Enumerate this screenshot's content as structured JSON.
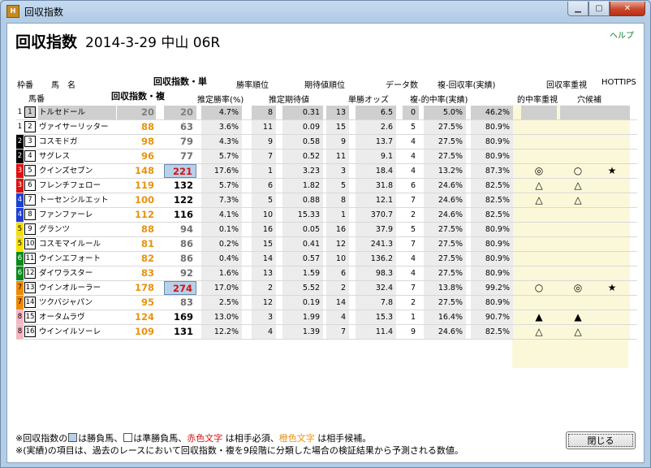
{
  "window": {
    "title": "回収指数",
    "icon_text": "H"
  },
  "header": {
    "title": "回収指数",
    "subtitle": "2014-3-29 中山 06R",
    "help": "ヘルプ"
  },
  "columns": {
    "waku": "枠番",
    "horse_name": "馬　名",
    "umaban": "馬番",
    "ri_tan": "回収指数・単",
    "ri_fuku": "回収指数・複",
    "win_rate": "推定勝率(%)",
    "win_rank": "勝率順位",
    "ev": "推定期待値",
    "ev_rank": "期待値順位",
    "odds": "単勝オッズ",
    "data_count": "データ数",
    "fuku_rate": "複-回収率(実績)",
    "hit_rate": "複-的中率(実績)",
    "hit_focus": "的中率重視",
    "ret_focus": "回収率重視",
    "ana": "穴候補",
    "hottips": "HOTTIPS"
  },
  "rows": [
    {
      "waku": "1",
      "wcol": "#ffffff",
      "wtxt": "#000",
      "uma": "1",
      "name": "トルセドール",
      "r1": "20",
      "r1c": "gray",
      "r2": "20",
      "r2c": "gray",
      "wr": "4.7%",
      "wrk": "8",
      "ev": "0.31",
      "evr": "13",
      "odds": "6.5",
      "dc": "0",
      "hit": "5.0%",
      "ret": "46.2%",
      "m1": "",
      "m2": "",
      "m3": "",
      "grayrow": true
    },
    {
      "waku": "1",
      "wcol": "#ffffff",
      "wtxt": "#000",
      "uma": "2",
      "name": "ヴァイサーリッター",
      "r1": "88",
      "r1c": "orange",
      "r2": "63",
      "r2c": "gray",
      "wr": "3.6%",
      "wrk": "11",
      "ev": "0.09",
      "evr": "15",
      "odds": "2.6",
      "dc": "5",
      "hit": "27.5%",
      "ret": "80.9%",
      "m1": "",
      "m2": "",
      "m3": ""
    },
    {
      "waku": "2",
      "wcol": "#000000",
      "wtxt": "#fff",
      "uma": "3",
      "name": "コスモドガ",
      "r1": "98",
      "r1c": "orange",
      "r2": "79",
      "r2c": "gray",
      "wr": "4.3%",
      "wrk": "9",
      "ev": "0.58",
      "evr": "9",
      "odds": "13.7",
      "dc": "4",
      "hit": "27.5%",
      "ret": "80.9%",
      "m1": "",
      "m2": "",
      "m3": ""
    },
    {
      "waku": "2",
      "wcol": "#000000",
      "wtxt": "#fff",
      "uma": "4",
      "name": "サグレス",
      "r1": "96",
      "r1c": "orange",
      "r2": "77",
      "r2c": "gray",
      "wr": "5.7%",
      "wrk": "7",
      "ev": "0.52",
      "evr": "11",
      "odds": "9.1",
      "dc": "4",
      "hit": "27.5%",
      "ret": "80.9%",
      "m1": "",
      "m2": "",
      "m3": ""
    },
    {
      "waku": "3",
      "wcol": "#e01010",
      "wtxt": "#fff",
      "uma": "5",
      "name": "クインズセブン",
      "r1": "148",
      "r1c": "orange",
      "r2": "221",
      "r2c": "red",
      "wr": "17.6%",
      "wrk": "1",
      "ev": "3.23",
      "evr": "3",
      "odds": "18.4",
      "dc": "4",
      "hit": "13.2%",
      "ret": "87.3%",
      "m1": "◎",
      "m2": "○",
      "m3": "★"
    },
    {
      "waku": "3",
      "wcol": "#e01010",
      "wtxt": "#fff",
      "uma": "6",
      "name": "フレンチフェロー",
      "r1": "119",
      "r1c": "orange",
      "r2": "132",
      "r2c": "orange",
      "wr": "5.7%",
      "wrk": "6",
      "ev": "1.82",
      "evr": "5",
      "odds": "31.8",
      "dc": "6",
      "hit": "24.6%",
      "ret": "82.5%",
      "m1": "△",
      "m2": "△",
      "m3": ""
    },
    {
      "waku": "4",
      "wcol": "#1c3fd6",
      "wtxt": "#fff",
      "uma": "7",
      "name": "トーセンシルエット",
      "r1": "100",
      "r1c": "orange",
      "r2": "122",
      "r2c": "orange",
      "wr": "7.3%",
      "wrk": "5",
      "ev": "0.88",
      "evr": "8",
      "odds": "12.1",
      "dc": "7",
      "hit": "24.6%",
      "ret": "82.5%",
      "m1": "△",
      "m2": "△",
      "m3": ""
    },
    {
      "waku": "4",
      "wcol": "#1c3fd6",
      "wtxt": "#fff",
      "uma": "8",
      "name": "ファンファーレ",
      "r1": "112",
      "r1c": "orange",
      "r2": "116",
      "r2c": "orange",
      "wr": "4.1%",
      "wrk": "10",
      "ev": "15.33",
      "evr": "1",
      "odds": "370.7",
      "dc": "2",
      "hit": "24.6%",
      "ret": "82.5%",
      "m1": "",
      "m2": "",
      "m3": ""
    },
    {
      "waku": "5",
      "wcol": "#f5e000",
      "wtxt": "#000",
      "uma": "9",
      "name": "グランツ",
      "r1": "88",
      "r1c": "orange",
      "r2": "94",
      "r2c": "gray",
      "wr": "0.1%",
      "wrk": "16",
      "ev": "0.05",
      "evr": "16",
      "odds": "37.9",
      "dc": "5",
      "hit": "27.5%",
      "ret": "80.9%",
      "m1": "",
      "m2": "",
      "m3": ""
    },
    {
      "waku": "5",
      "wcol": "#f5e000",
      "wtxt": "#000",
      "uma": "10",
      "name": "コスモマイルール",
      "r1": "81",
      "r1c": "orange",
      "r2": "86",
      "r2c": "gray",
      "wr": "0.2%",
      "wrk": "15",
      "ev": "0.41",
      "evr": "12",
      "odds": "241.3",
      "dc": "7",
      "hit": "27.5%",
      "ret": "80.9%",
      "m1": "",
      "m2": "",
      "m3": ""
    },
    {
      "waku": "6",
      "wcol": "#0a8a1a",
      "wtxt": "#fff",
      "uma": "11",
      "name": "ウインエフォート",
      "r1": "82",
      "r1c": "orange",
      "r2": "86",
      "r2c": "gray",
      "wr": "0.4%",
      "wrk": "14",
      "ev": "0.57",
      "evr": "10",
      "odds": "136.2",
      "dc": "4",
      "hit": "27.5%",
      "ret": "80.9%",
      "m1": "",
      "m2": "",
      "m3": ""
    },
    {
      "waku": "6",
      "wcol": "#0a8a1a",
      "wtxt": "#fff",
      "uma": "12",
      "name": "ダイワラスター",
      "r1": "83",
      "r1c": "orange",
      "r2": "92",
      "r2c": "gray",
      "wr": "1.6%",
      "wrk": "13",
      "ev": "1.59",
      "evr": "6",
      "odds": "98.3",
      "dc": "4",
      "hit": "27.5%",
      "ret": "80.9%",
      "m1": "",
      "m2": "",
      "m3": ""
    },
    {
      "waku": "7",
      "wcol": "#f08a00",
      "wtxt": "#000",
      "uma": "13",
      "name": "ウインオルーラー",
      "r1": "178",
      "r1c": "orange",
      "r2": "274",
      "r2c": "red",
      "wr": "17.0%",
      "wrk": "2",
      "ev": "5.52",
      "evr": "2",
      "odds": "32.4",
      "dc": "7",
      "hit": "13.8%",
      "ret": "99.2%",
      "m1": "○",
      "m2": "◎",
      "m3": "★"
    },
    {
      "waku": "7",
      "wcol": "#f08a00",
      "wtxt": "#000",
      "uma": "14",
      "name": "ツクバジャパン",
      "r1": "95",
      "r1c": "orange",
      "r2": "83",
      "r2c": "gray",
      "wr": "2.5%",
      "wrk": "12",
      "ev": "0.19",
      "evr": "14",
      "odds": "7.8",
      "dc": "2",
      "hit": "27.5%",
      "ret": "80.9%",
      "m1": "",
      "m2": "",
      "m3": ""
    },
    {
      "waku": "8",
      "wcol": "#f7b6c0",
      "wtxt": "#000",
      "uma": "15",
      "name": "オータムラヴ",
      "r1": "124",
      "r1c": "orange",
      "r2": "169",
      "r2c": "orange",
      "wr": "13.0%",
      "wrk": "3",
      "ev": "1.99",
      "evr": "4",
      "odds": "15.3",
      "dc": "1",
      "hit": "16.4%",
      "ret": "90.7%",
      "m1": "▲",
      "m2": "▲",
      "m3": ""
    },
    {
      "waku": "8",
      "wcol": "#f7b6c0",
      "wtxt": "#000",
      "uma": "16",
      "name": "ウインイルソーレ",
      "r1": "109",
      "r1c": "orange",
      "r2": "131",
      "r2c": "orange",
      "wr": "12.2%",
      "wrk": "4",
      "ev": "1.39",
      "evr": "7",
      "odds": "11.4",
      "dc": "9",
      "hit": "24.6%",
      "ret": "82.5%",
      "m1": "△",
      "m2": "△",
      "m3": ""
    }
  ],
  "footnotes": {
    "l1_a": "※回収指数の",
    "l1_b": "は勝負馬、",
    "l1_c": "は準勝負馬、",
    "l1_d": "赤色文字",
    "l1_e": "は相手必須、",
    "l1_f": "橙色文字",
    "l1_g": "は相手候補。",
    "l2": "※(実績)の項目は、過去のレースにおいて回収指数・複を9段階に分類した場合の検証結果から予測される数値。"
  },
  "close_button": "閉じる"
}
